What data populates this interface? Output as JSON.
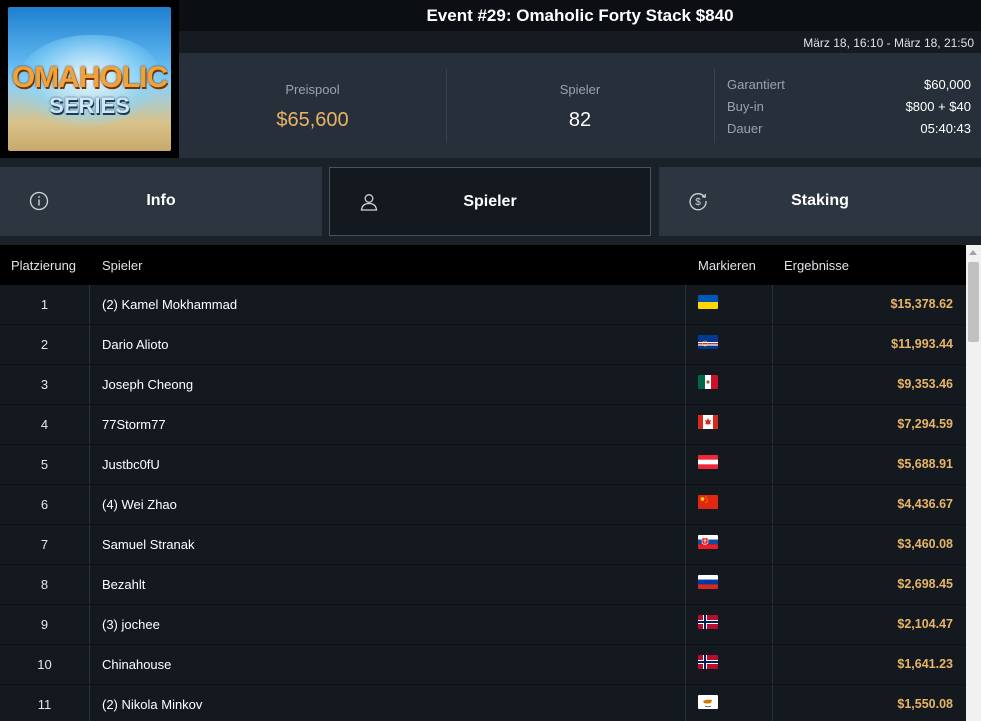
{
  "logo": {
    "line1": "OMAHOLIC",
    "line2": "SERIES"
  },
  "header": {
    "title": "Event #29: Omaholic Forty Stack $840",
    "date_range": "März 18, 16:10 - März 18, 21:50"
  },
  "stats": {
    "prize_pool_label": "Preispool",
    "prize_pool_value": "$65,600",
    "players_label": "Spieler",
    "players_value": "82",
    "details": [
      {
        "key": "Garantiert",
        "value": "$60,000"
      },
      {
        "key": "Buy-in",
        "value": "$800 + $40"
      },
      {
        "key": "Dauer",
        "value": "05:40:43"
      }
    ]
  },
  "tabs": [
    {
      "label": "Info",
      "icon": "info-icon",
      "active": false
    },
    {
      "label": "Spieler",
      "icon": "user-icon",
      "active": true
    },
    {
      "label": "Staking",
      "icon": "dollar-cycle-icon",
      "active": false
    }
  ],
  "colors": {
    "accent_gold": "#e8b566",
    "bg": "#1b2129"
  },
  "table": {
    "headers": {
      "rank": "Platzierung",
      "player": "Spieler",
      "mark": "Markieren",
      "results": "Ergebnisse"
    },
    "rows": [
      {
        "rank": "1",
        "player": "(2) Kamel Mokhammad",
        "flag": "ukraine",
        "result": "$15,378.62"
      },
      {
        "rank": "2",
        "player": "Dario Alioto",
        "flag": "cape-verde",
        "result": "$11,993.44"
      },
      {
        "rank": "3",
        "player": "Joseph Cheong",
        "flag": "mexico",
        "result": "$9,353.46"
      },
      {
        "rank": "4",
        "player": "77Storm77",
        "flag": "canada",
        "result": "$7,294.59"
      },
      {
        "rank": "5",
        "player": "Justbc0fU",
        "flag": "austria",
        "result": "$5,688.91"
      },
      {
        "rank": "6",
        "player": "(4) Wei Zhao",
        "flag": "china",
        "result": "$4,436.67"
      },
      {
        "rank": "7",
        "player": "Samuel Stranak",
        "flag": "slovakia",
        "result": "$3,460.08"
      },
      {
        "rank": "8",
        "player": "Bezahlt",
        "flag": "russia",
        "result": "$2,698.45"
      },
      {
        "rank": "9",
        "player": "(3) jochee",
        "flag": "norway",
        "result": "$2,104.47"
      },
      {
        "rank": "10",
        "player": "Chinahouse",
        "flag": "norway",
        "result": "$1,641.23"
      },
      {
        "rank": "11",
        "player": "(2) Nikola Minkov",
        "flag": "cyprus",
        "result": "$1,550.08"
      }
    ]
  }
}
